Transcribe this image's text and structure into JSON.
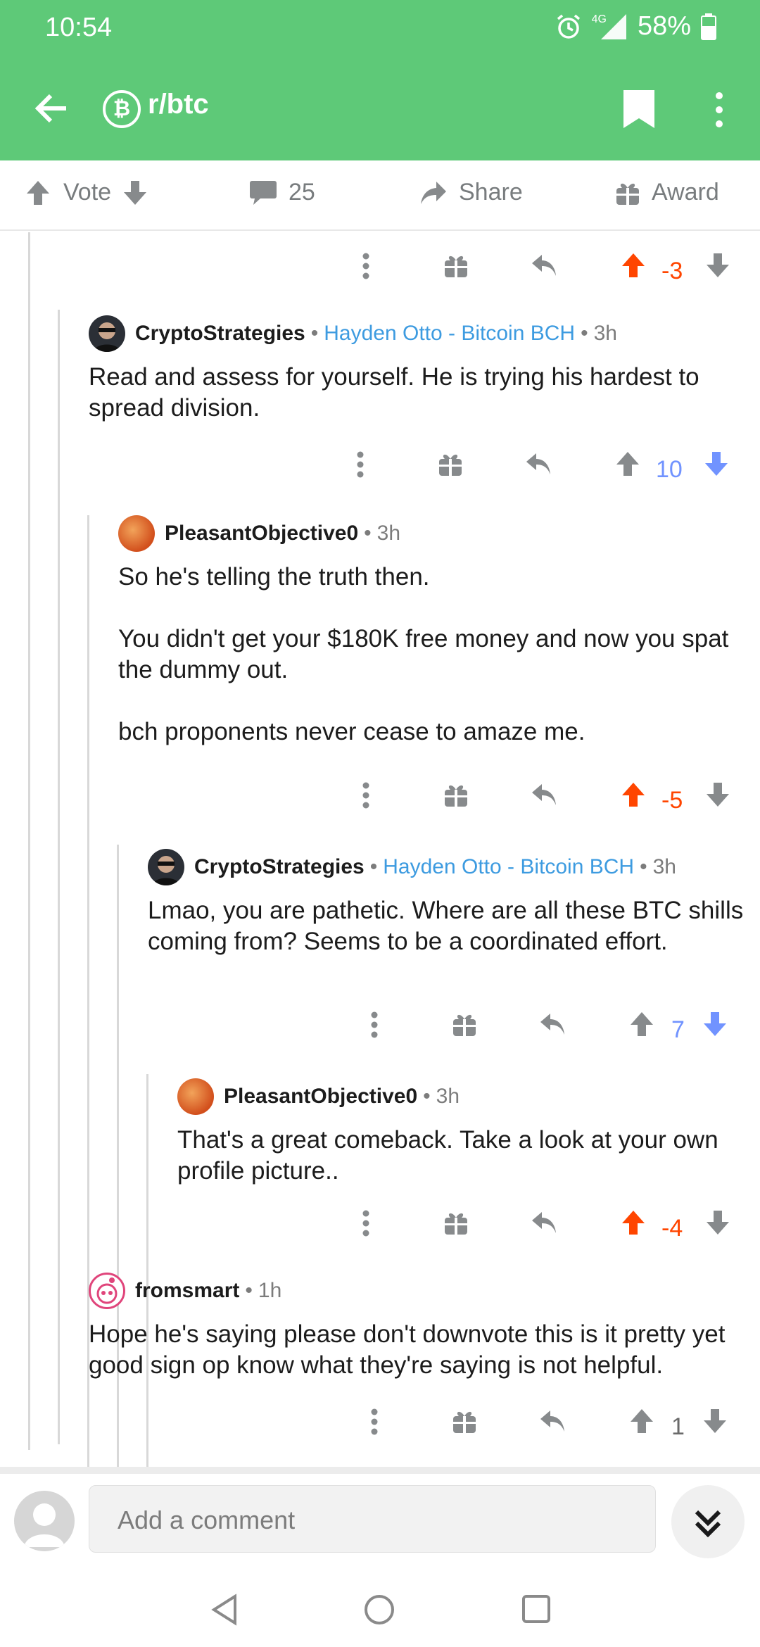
{
  "status": {
    "time": "10:54",
    "network": "4G",
    "battery": "58%"
  },
  "header": {
    "subreddit": "r/btc"
  },
  "actionbar": {
    "vote_label": "Vote",
    "comments_count": "25",
    "share_label": "Share",
    "award_label": "Award"
  },
  "top_actions": {
    "score": "-3"
  },
  "comments": [
    {
      "author": "CryptoStrategies",
      "flair": "Hayden Otto - Bitcoin BCH",
      "age": "3h",
      "text": "Read and assess for yourself. He is trying his hardest to spread division.",
      "score": "10"
    },
    {
      "author": "PleasantObjective0",
      "age": "3h",
      "text": "So he's telling the truth then.\n\nYou didn't get your $180K free money and now you spat the dummy out.\n\nbch proponents never cease to amaze me.",
      "score": "-5"
    },
    {
      "author": "CryptoStrategies",
      "flair": "Hayden Otto - Bitcoin BCH",
      "age": "3h",
      "text": "Lmao, you are pathetic. Where are all these BTC shills coming from? Seems to be a coordinated effort.",
      "score": "7"
    },
    {
      "author": "PleasantObjective0",
      "age": "3h",
      "text": "That's a great comeback.  Take a look at your own profile picture..",
      "score": "-4"
    },
    {
      "author": "fromsmart",
      "age": "1h",
      "text": "Hope he's saying please don't downvote this is it pretty yet good sign op know what they're saying is not helpful.",
      "score": "1"
    }
  ],
  "composer": {
    "placeholder": "Add a comment"
  },
  "colors": {
    "header_bg": "#5ec978",
    "downvote_score": "#ff4500",
    "upvote_score": "#7193ff",
    "flair": "#3d9be0"
  }
}
